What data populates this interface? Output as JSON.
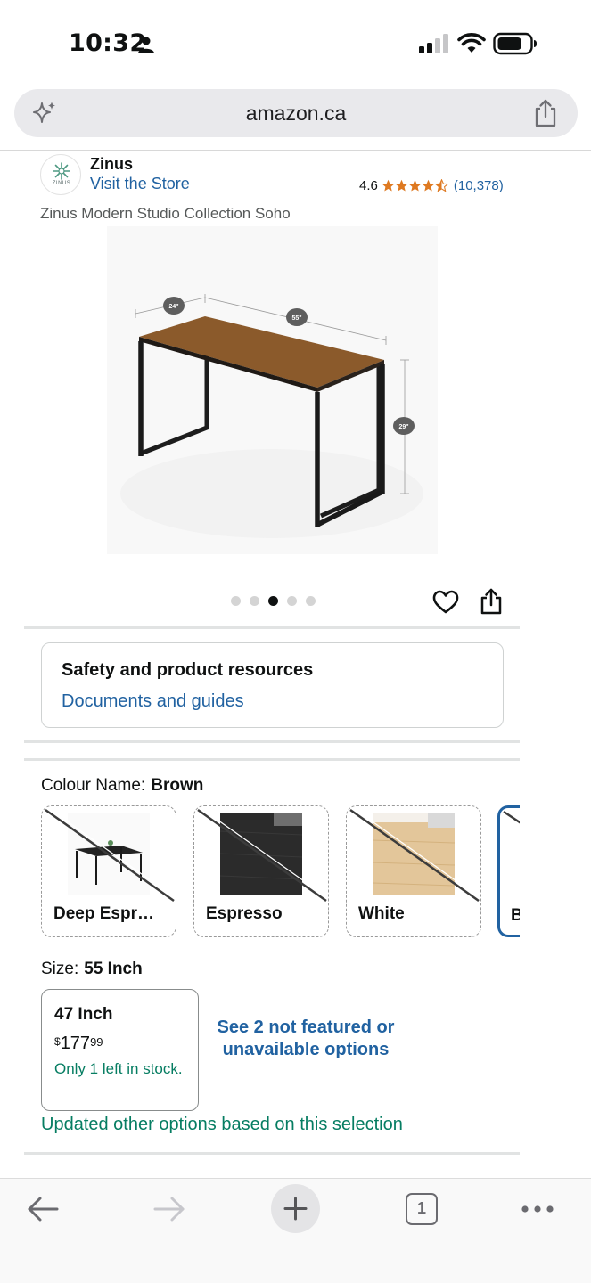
{
  "status_bar": {
    "time": "10:32",
    "icons": [
      "person-icon",
      "cellular-signal-icon",
      "wifi-icon",
      "battery-icon"
    ]
  },
  "browser": {
    "url": "amazon.ca",
    "icons": [
      "sparkle-icon",
      "share-icon"
    ]
  },
  "brand": {
    "name": "Zinus",
    "logo_text": "ZINUS",
    "store_link": "Visit the Store",
    "rating": "4.6",
    "rating_count": "(10,378)",
    "stars": 4.5,
    "star_color": "#de7921"
  },
  "product": {
    "title": "Zinus Modern Studio Collection Soho",
    "dimensions": {
      "depth": "24\"",
      "width": "55\"",
      "height": "29\""
    },
    "image_count": 5,
    "active_image_index": 3
  },
  "safety": {
    "title": "Safety and product resources",
    "link": "Documents and guides"
  },
  "colour": {
    "label": "Colour Name:",
    "selected": "Brown",
    "options": [
      {
        "label": "Deep Espr…",
        "available": false
      },
      {
        "label": "Espresso",
        "available": false
      },
      {
        "label": "White",
        "available": false
      },
      {
        "label": "B",
        "available": true
      }
    ]
  },
  "size": {
    "label": "Size:",
    "selected": "55 Inch",
    "option": {
      "name": "47 Inch",
      "currency": "$",
      "price_dollars": "177",
      "price_cents": "99",
      "stock": "Only 1 left in stock."
    },
    "unavailable_link": "See 2 not featured or unavailable options",
    "updated_note": "Updated other options based on this selection"
  },
  "toolbar": {
    "tab_count": "1",
    "icons": [
      "back-arrow-icon",
      "forward-arrow-icon",
      "plus-icon",
      "tabs-icon",
      "more-icon"
    ]
  },
  "colors": {
    "link": "#2162a1",
    "success": "#067d62",
    "star": "#de7921"
  }
}
